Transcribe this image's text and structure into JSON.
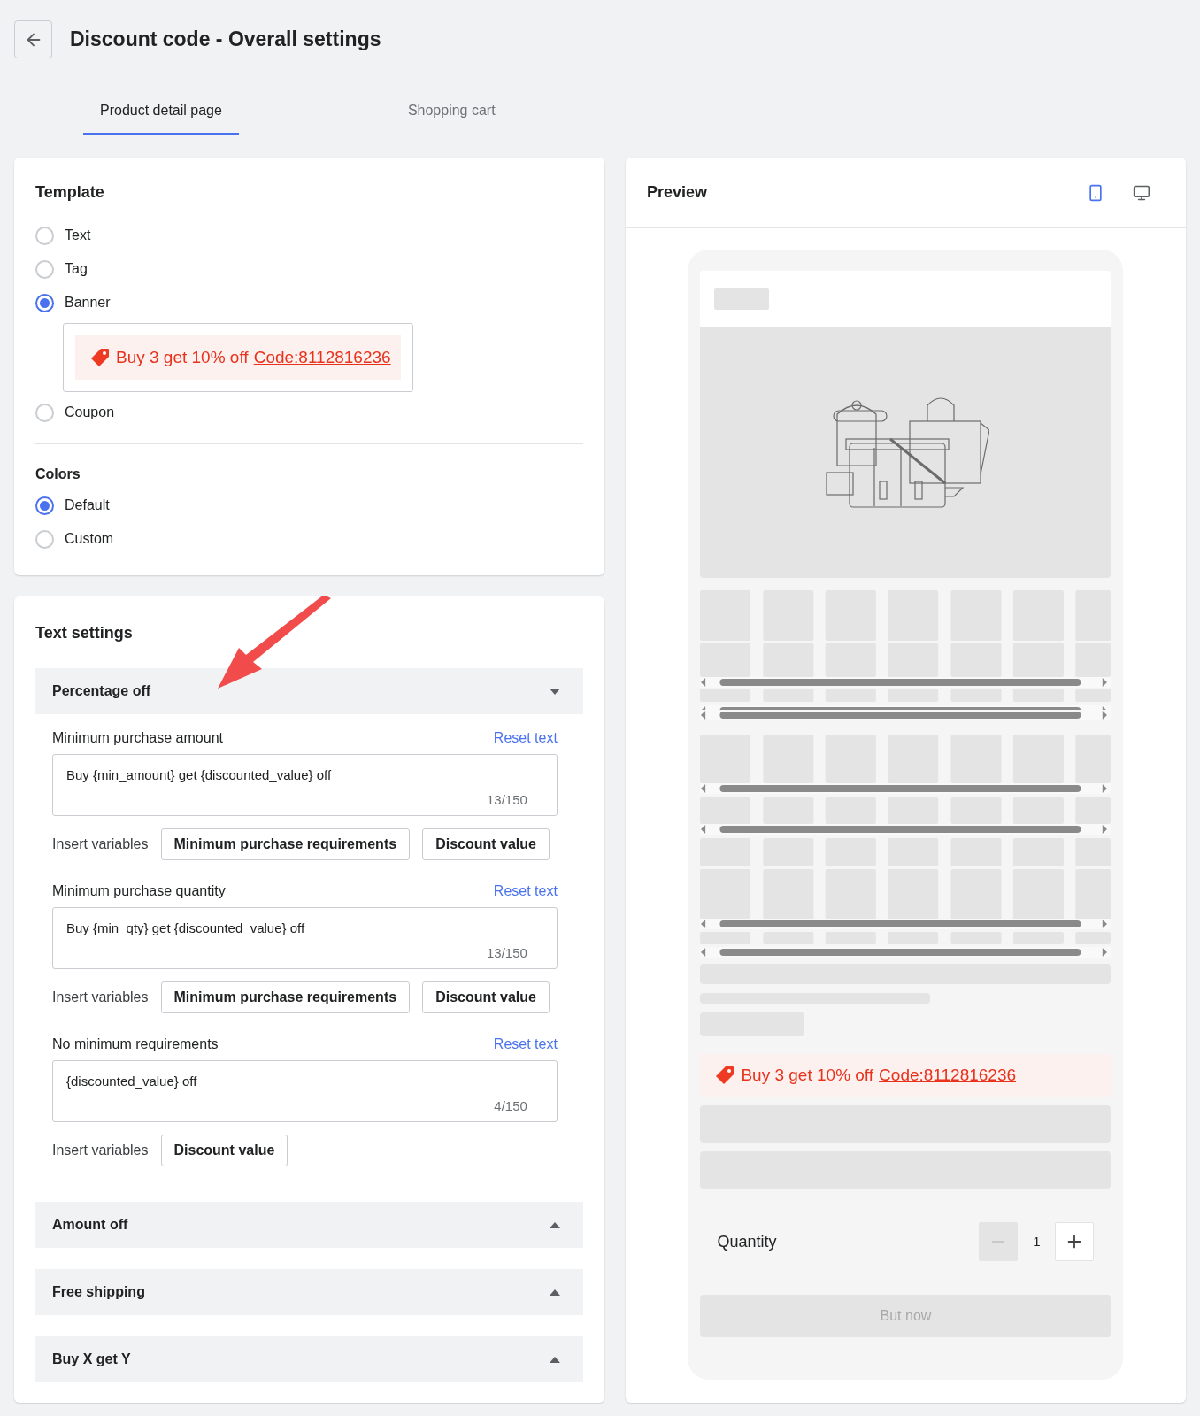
{
  "page": {
    "title": "Discount code - Overall settings"
  },
  "tabs": [
    {
      "label": "Product detail page",
      "selected": true
    },
    {
      "label": "Shopping cart",
      "selected": false
    }
  ],
  "template": {
    "title": "Template",
    "options": [
      {
        "label": "Text",
        "selected": false
      },
      {
        "label": "Tag",
        "selected": false
      },
      {
        "label": "Banner",
        "selected": true,
        "banner": {
          "text": "Buy 3 get 10% off",
          "code": "Code:8112816236"
        }
      },
      {
        "label": "Coupon",
        "selected": false
      }
    ]
  },
  "colors": {
    "title": "Colors",
    "options": [
      {
        "label": "Default",
        "selected": true
      },
      {
        "label": "Custom",
        "selected": false
      }
    ]
  },
  "text_settings": {
    "title": "Text settings",
    "sections": [
      {
        "title": "Percentage off",
        "expanded": true,
        "fields": [
          {
            "label": "Minimum purchase amount",
            "reset": "Reset text",
            "value": "Buy {min_amount} get {discounted_value} off",
            "counter": "13/150",
            "variables_label": "Insert variables",
            "variables": [
              "Minimum purchase requirements",
              "Discount value"
            ]
          },
          {
            "label": "Minimum purchase quantity",
            "reset": "Reset text",
            "value": "Buy {min_qty} get {discounted_value} off",
            "counter": "13/150",
            "variables_label": "Insert variables",
            "variables": [
              "Minimum purchase requirements",
              "Discount value"
            ]
          },
          {
            "label": "No minimum requirements",
            "reset": "Reset text",
            "value": "{discounted_value} off",
            "counter": "4/150",
            "variables_label": "Insert variables",
            "variables": [
              "Discount value"
            ]
          }
        ]
      },
      {
        "title": "Amount off",
        "expanded": false
      },
      {
        "title": "Free shipping",
        "expanded": false
      },
      {
        "title": "Buy X get Y",
        "expanded": false
      }
    ]
  },
  "preview": {
    "title": "Preview",
    "devices": [
      {
        "kind": "mobile",
        "selected": true
      },
      {
        "kind": "desktop",
        "selected": false
      }
    ],
    "banner": {
      "text": "Buy 3 get 10% off",
      "code": "Code:8112816236"
    },
    "quantity_label": "Quantity",
    "quantity": "1",
    "buy_button": "But now"
  }
}
